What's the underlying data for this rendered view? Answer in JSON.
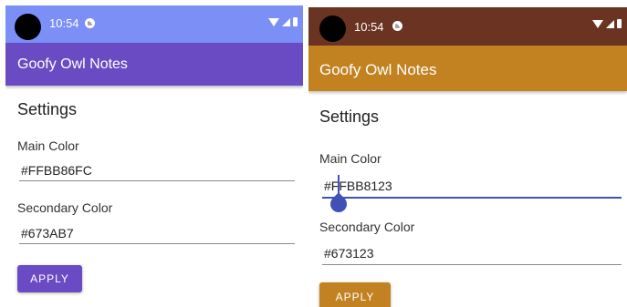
{
  "left_screen": {
    "colors": {
      "status_bar": "#7b8ff7",
      "app_bar": "#6a4bc3",
      "button": "#6a4bc3"
    },
    "status_bar": {
      "time": "10:54"
    },
    "app_bar": {
      "title": "Goofy Owl Notes"
    },
    "settings": {
      "heading": "Settings",
      "main_color_label": "Main Color",
      "main_color_value": "#FFBB86FC",
      "secondary_color_label": "Secondary Color",
      "secondary_color_value": "#673AB7",
      "apply_label": "APPLY"
    }
  },
  "right_screen": {
    "colors": {
      "status_bar": "#6b3322",
      "app_bar": "#c28221",
      "button": "#c28221",
      "focus": "#3f51b5"
    },
    "status_bar": {
      "time": "10:54"
    },
    "app_bar": {
      "title": "Goofy Owl Notes"
    },
    "settings": {
      "heading": "Settings",
      "main_color_label": "Main Color",
      "main_color_value": "#FFBB8123",
      "secondary_color_label": "Secondary Color",
      "secondary_color_value": "#673123",
      "apply_label": "APPLY"
    }
  }
}
